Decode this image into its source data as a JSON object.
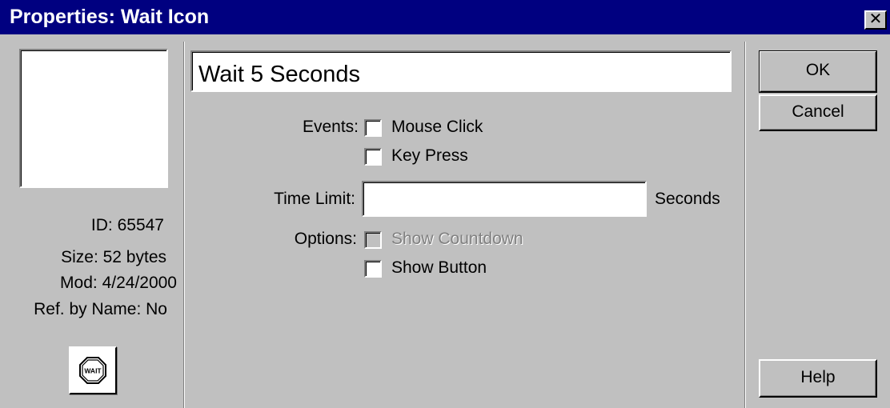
{
  "window": {
    "title": "Properties: Wait Icon",
    "close_label": "✕"
  },
  "icon_info": {
    "id": "ID: 65547",
    "size": "Size: 52 bytes",
    "mod": "Mod: 4/24/2000",
    "ref_by_name": "Ref. by Name: No",
    "icon_glyph_text": "WAIT",
    "icon": "wait-stop-sign-icon"
  },
  "form": {
    "name_value": "Wait 5 Seconds",
    "events_label": "Events:",
    "events": {
      "mouse_click": {
        "label": "Mouse Click",
        "checked": false
      },
      "key_press": {
        "label": "Key Press",
        "checked": false
      }
    },
    "time_limit_label": "Time Limit:",
    "time_limit_value": "",
    "time_limit_unit": "Seconds",
    "options_label": "Options:",
    "options": {
      "show_countdown": {
        "label": "Show Countdown",
        "checked": false,
        "enabled": false
      },
      "show_button": {
        "label": "Show Button",
        "checked": false,
        "enabled": true
      }
    }
  },
  "buttons": {
    "ok": "OK",
    "cancel": "Cancel",
    "help": "Help"
  },
  "colors": {
    "titlebar": "#000080",
    "face": "#c0c0c0",
    "field": "#ffffff"
  }
}
